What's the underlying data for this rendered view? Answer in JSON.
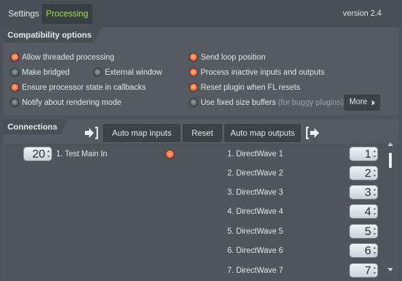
{
  "tabs": {
    "settings": "Settings",
    "processing": "Processing"
  },
  "version": "version 2.4",
  "compatibility": {
    "title": "Compatibility options",
    "options": [
      {
        "label": "Allow threaded processing",
        "checked": true
      },
      {
        "label": "Make bridged",
        "checked": false
      },
      {
        "label": "External window",
        "checked": false
      },
      {
        "label": "Ensure processor state in callbacks",
        "checked": true
      },
      {
        "label": "Notify about rendering mode",
        "checked": false
      },
      {
        "label": "Send loop position",
        "checked": true
      },
      {
        "label": "Process inactive inputs and outputs",
        "checked": true
      },
      {
        "label": "Reset plugin when FL resets",
        "checked": true
      },
      {
        "label": "Use fixed size buffers",
        "hint": "(for buggy plugins)",
        "checked": false
      }
    ],
    "more_label": "More"
  },
  "connections": {
    "title": "Connections",
    "auto_map_inputs": "Auto map inputs",
    "reset": "Reset",
    "auto_map_outputs": "Auto map outputs",
    "input": {
      "number": "20",
      "label": "1. Test Main In"
    },
    "outputs": [
      {
        "label": "1. DirectWave 1",
        "number": "1"
      },
      {
        "label": "2. DirectWave 2",
        "number": "2"
      },
      {
        "label": "3. DirectWave 3",
        "number": "3"
      },
      {
        "label": "4. DirectWave 4",
        "number": "4"
      },
      {
        "label": "5. DirectWave 5",
        "number": "5"
      },
      {
        "label": "6. DirectWave 6",
        "number": "6"
      },
      {
        "label": "7. DirectWave 7",
        "number": "7"
      }
    ]
  },
  "colors": {
    "accent_tab": "#9fe04a",
    "radio_on": "#ff8a5a",
    "background": "#4d5358"
  },
  "icons": {
    "input": "input-arrow-icon",
    "output": "output-arrow-icon"
  }
}
